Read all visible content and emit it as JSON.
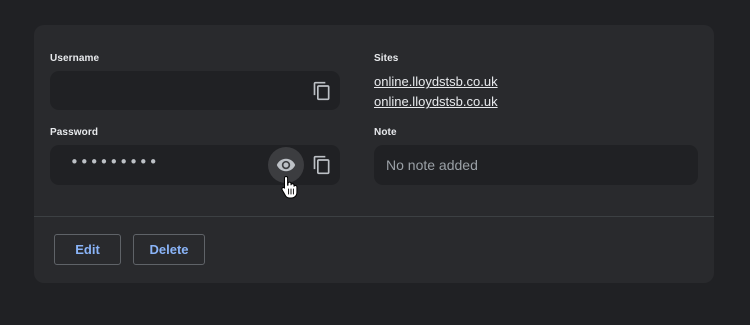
{
  "username": {
    "label": "Username",
    "value": "",
    "copy_icon": "copy-icon"
  },
  "password": {
    "label": "Password",
    "masked_value": "•••••••••",
    "show_icon": "eye-icon",
    "copy_icon": "copy-icon"
  },
  "sites": {
    "label": "Sites",
    "items": [
      "online.lloydstsb.co.uk",
      "online.lloydstsb.co.uk"
    ]
  },
  "note": {
    "label": "Note",
    "placeholder": "No note added"
  },
  "actions": {
    "edit_label": "Edit",
    "delete_label": "Delete"
  },
  "colors": {
    "background": "#202124",
    "card": "#292a2d",
    "field": "#202124",
    "accent": "#8ab4f8",
    "text": "#e8eaed"
  }
}
